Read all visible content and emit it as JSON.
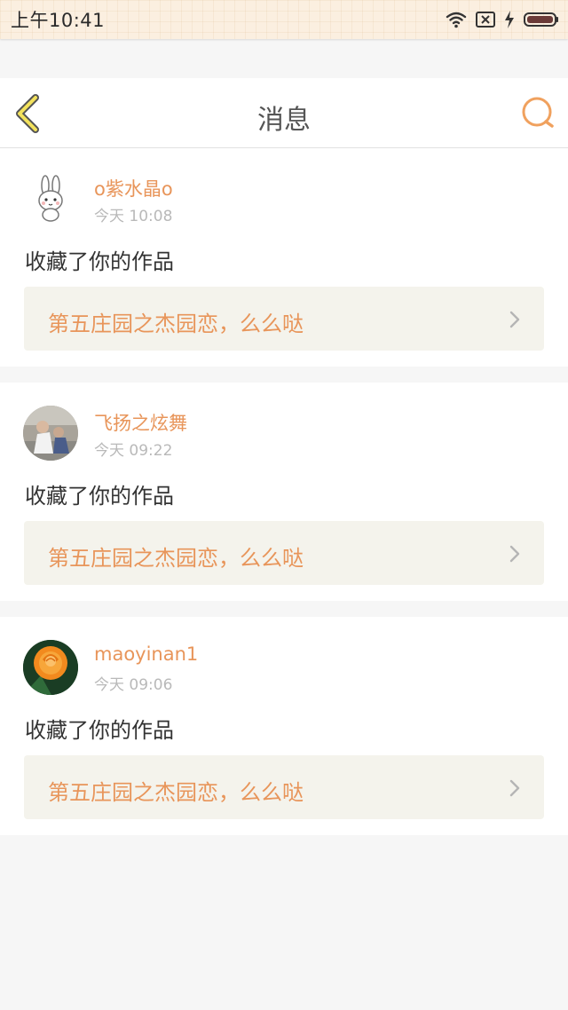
{
  "status_bar": {
    "time": "上午10:41",
    "icons": [
      "wifi-icon",
      "sim-x-icon",
      "charging-icon",
      "battery-icon"
    ]
  },
  "header": {
    "title": "消息",
    "back_icon": "chevron-left-icon",
    "search_icon": "search-icon",
    "accent_color": "#e8955a"
  },
  "messages": [
    {
      "username": "o紫水晶o",
      "time": "今天 10:08",
      "action": "收藏了你的作品",
      "work_title": "第五庄园之杰园恋，么么哒",
      "avatar": "bunny-avatar"
    },
    {
      "username": "飞扬之炫舞",
      "time": "今天 09:22",
      "action": "收藏了你的作品",
      "work_title": "第五庄园之杰园恋，么么哒",
      "avatar": "photo-avatar"
    },
    {
      "username": "maoyinan1",
      "time": "今天 09:06",
      "action": "收藏了你的作品",
      "work_title": "第五庄园之杰园恋，么么哒",
      "avatar": "rose-avatar"
    }
  ]
}
